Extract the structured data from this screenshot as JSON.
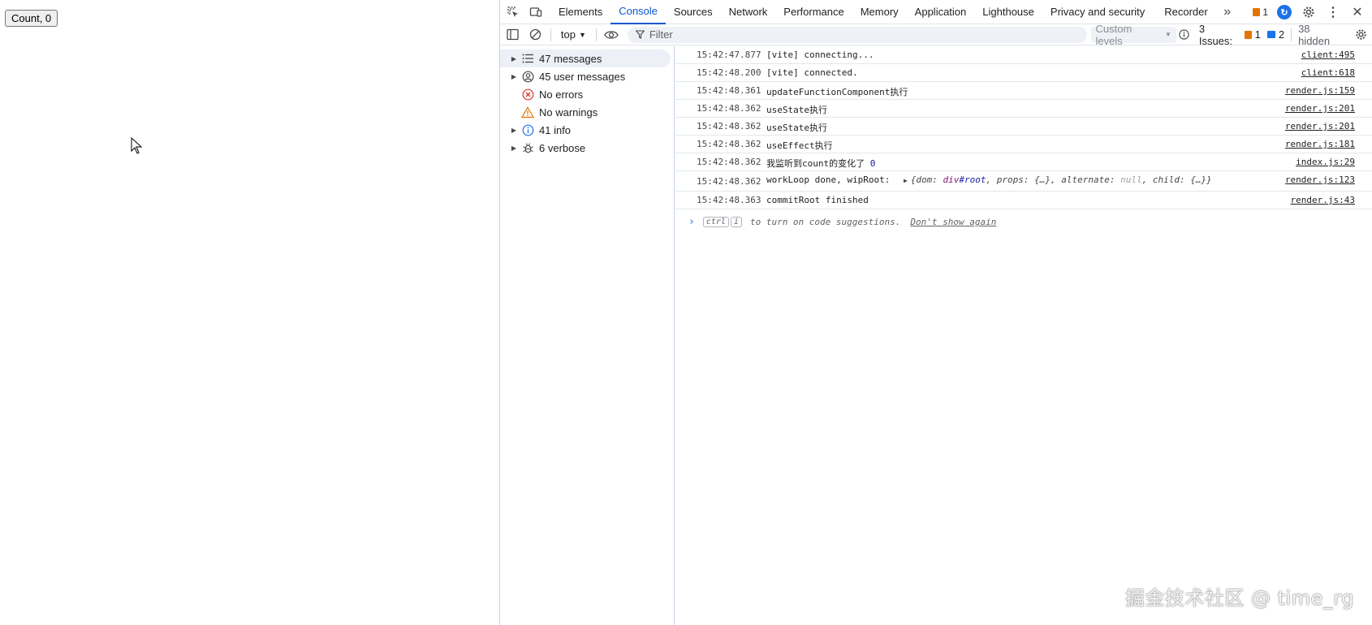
{
  "page": {
    "button_label": "Count, 0"
  },
  "devtools": {
    "tabs": [
      {
        "label": "Elements"
      },
      {
        "label": "Console"
      },
      {
        "label": "Sources"
      },
      {
        "label": "Network"
      },
      {
        "label": "Performance"
      },
      {
        "label": "Memory"
      },
      {
        "label": "Application"
      },
      {
        "label": "Lighthouse"
      },
      {
        "label": "Privacy and security"
      },
      {
        "label": "Recorder"
      }
    ],
    "active_tab": "Console",
    "more_tabs_icon": "chevron-double-right-icon",
    "issue_badge_count": "1",
    "toolbar": {
      "context": "top",
      "filter_placeholder": "Filter",
      "levels": "Custom levels",
      "issues_label": "3 Issues:",
      "issues_warning_count": "1",
      "issues_info_count": "2",
      "hidden": "38 hidden"
    },
    "sidebar": {
      "items": [
        {
          "label": "47 messages",
          "icon": "list-icon",
          "expandable": true
        },
        {
          "label": "45 user messages",
          "icon": "user-icon",
          "expandable": true
        },
        {
          "label": "No errors",
          "icon": "error-icon",
          "expandable": false
        },
        {
          "label": "No warnings",
          "icon": "warning-icon",
          "expandable": false
        },
        {
          "label": "41 info",
          "icon": "info-icon",
          "expandable": true
        },
        {
          "label": "6 verbose",
          "icon": "bug-icon",
          "expandable": true
        }
      ]
    },
    "console": {
      "rows": [
        {
          "time": "15:42:47.877",
          "text": "[vite] connecting...",
          "source": "client:495"
        },
        {
          "time": "15:42:48.200",
          "text": "[vite] connected.",
          "source": "client:618"
        },
        {
          "time": "15:42:48.361",
          "text": "updateFunctionComponent执行",
          "source": "render.js:159"
        },
        {
          "time": "15:42:48.362",
          "text": "useState执行",
          "source": "render.js:201"
        },
        {
          "time": "15:42:48.362",
          "text": "useState执行",
          "source": "render.js:201"
        },
        {
          "time": "15:42:48.362",
          "text": "useEffect执行",
          "source": "render.js:181"
        },
        {
          "time": "15:42:48.362",
          "text": "我监听到count的变化了",
          "value": "0",
          "source": "index.js:29"
        },
        {
          "time": "15:42:48.362",
          "text": "workLoop done, wipRoot:",
          "source": "render.js:123",
          "object": {
            "open": "{dom: ",
            "tag": "div",
            "attr": "#root",
            "mid": ", props: {…}, alternate: ",
            "nul": "null",
            "end": ", child: {…}}"
          }
        },
        {
          "time": "15:42:48.363",
          "text": "commitRoot finished",
          "source": "render.js:43"
        }
      ],
      "prompt": {
        "key1": "ctrl",
        "key2": "i",
        "hint": "to turn on code suggestions.",
        "dismiss": "Don't show again"
      }
    }
  },
  "watermark": "掘金技术社区 @ time_rg"
}
